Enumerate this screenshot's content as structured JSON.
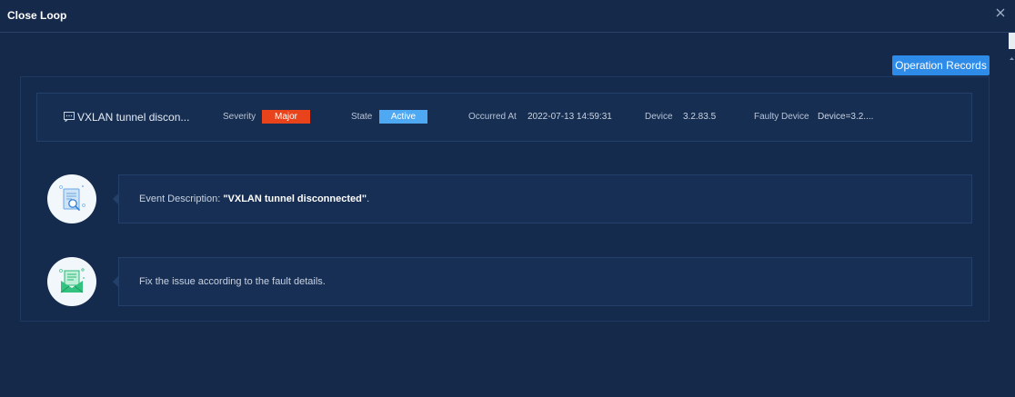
{
  "dialog": {
    "title": "Close Loop"
  },
  "toolbar": {
    "operation_records_label": "Operation Records"
  },
  "alarm": {
    "name": "VXLAN tunnel discon...",
    "severity_label": "Severity",
    "severity_value": "Major",
    "state_label": "State",
    "state_value": "Active",
    "occurred_label": "Occurred At",
    "occurred_value": "2022-07-13 14:59:31",
    "device_label": "Device",
    "device_value": "3.2.83.5",
    "faulty_device_label": "Faulty Device",
    "faulty_device_value": "Device=3.2...."
  },
  "steps": [
    {
      "prefix": "Event Description: ",
      "highlight": "\"VXLAN tunnel disconnected\"",
      "suffix": "."
    },
    {
      "text": "Fix the issue according to the fault details."
    }
  ],
  "colors": {
    "background": "#15294a",
    "primary_button": "#2e8be8",
    "severity_major": "#e8431a",
    "state_active": "#4ea8f2"
  },
  "icons": {
    "close": "close-icon",
    "alarm": "message-icon",
    "step1": "document-search-icon",
    "step2": "mail-document-icon"
  }
}
